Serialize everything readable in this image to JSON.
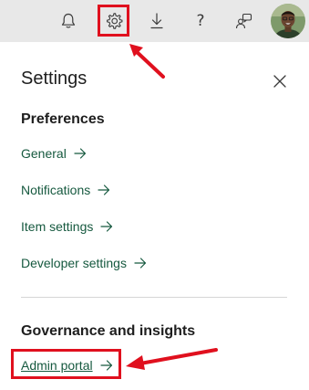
{
  "header": {
    "icons": [
      "bell-icon",
      "gear-icon",
      "download-icon",
      "help-icon",
      "people-icon",
      "avatar"
    ],
    "help_glyph": "?"
  },
  "panel": {
    "title": "Settings",
    "sections": [
      {
        "heading": "Preferences",
        "links": [
          "General",
          "Notifications",
          "Item settings",
          "Developer settings"
        ]
      },
      {
        "heading": "Governance and insights",
        "links": [
          "Admin portal"
        ]
      }
    ]
  },
  "colors": {
    "link": "#16593f",
    "highlight": "#e0101e",
    "topbar": "#e8e8e8"
  }
}
